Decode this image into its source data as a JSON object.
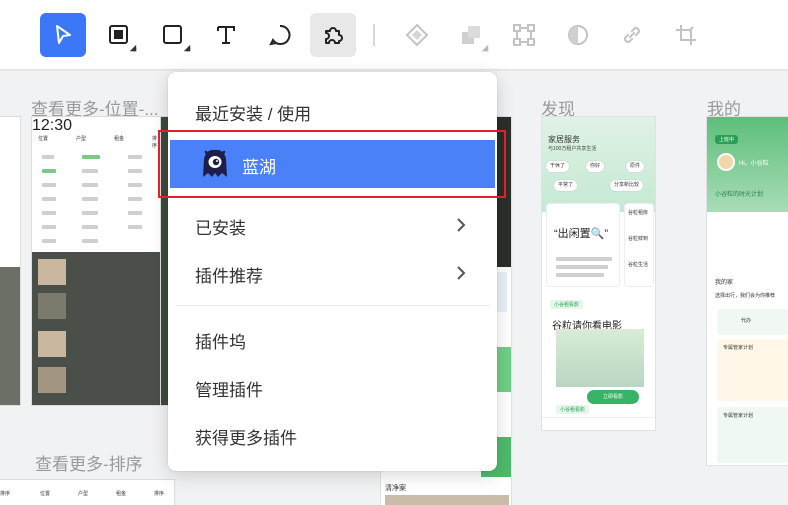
{
  "toolbar": {
    "tools": [
      {
        "name": "select",
        "icon": "select-arrow-icon"
      },
      {
        "name": "frame",
        "icon": "frame-icon"
      },
      {
        "name": "rectangle",
        "icon": "rectangle-icon"
      },
      {
        "name": "text",
        "icon": "text-icon"
      },
      {
        "name": "comment",
        "icon": "comment-icon"
      },
      {
        "name": "plugins",
        "icon": "plugin-icon"
      },
      {
        "name": "component",
        "icon": "component-icon"
      },
      {
        "name": "boolean",
        "icon": "boolean-icon"
      },
      {
        "name": "path-edit",
        "icon": "path-edit-icon"
      },
      {
        "name": "mask",
        "icon": "mask-icon"
      },
      {
        "name": "link",
        "icon": "link-icon"
      },
      {
        "name": "crop",
        "icon": "crop-icon"
      }
    ],
    "accent": "#3b77f6"
  },
  "canvas": {
    "frames": {
      "view_more_position": "查看更多-位置-...",
      "view_more_sort": "查看更多-排序",
      "discover": "发现",
      "mine": "我的"
    },
    "status_time": "12:30",
    "filters_top": [
      "位置",
      "户型",
      "租金",
      "排序"
    ],
    "filters_bottom": [
      "排序",
      "位置",
      "户型",
      "租金",
      "排序"
    ],
    "discover": {
      "title": "家居服务",
      "subtitle": "与100万租户共享生活",
      "chips": [
        "干休了",
        "你好",
        "原件",
        "平常了",
        "分享新比较"
      ],
      "headline": "“出闲置🔍”",
      "movie_tag": "小谷租看影",
      "movie_title": "谷粒请你看电影",
      "side_cards": [
        "谷粒租房",
        "谷粒鲜到",
        "谷粒生活"
      ],
      "button": "立即看影",
      "tag": "小谷租看影"
    },
    "mine": {
      "badge": "上班中",
      "greeting": "Hi，小谷粒",
      "plan": "小谷粒的时光计划",
      "section": "我的家",
      "section2": "选择出行，我们会为你推荐",
      "cards": [
        "代办",
        "专属管家计划",
        "专属管家计划"
      ]
    },
    "middle_caption": "清净案"
  },
  "menu": {
    "header": "最近安装 / 使用",
    "selected_app": "蓝湖",
    "items": {
      "installed": "已安装",
      "recommended": "插件推荐",
      "dock": "插件坞",
      "manage": "管理插件",
      "more": "获得更多插件"
    },
    "highlight_color": "#e0202a",
    "selected_color": "#4a80f8"
  }
}
